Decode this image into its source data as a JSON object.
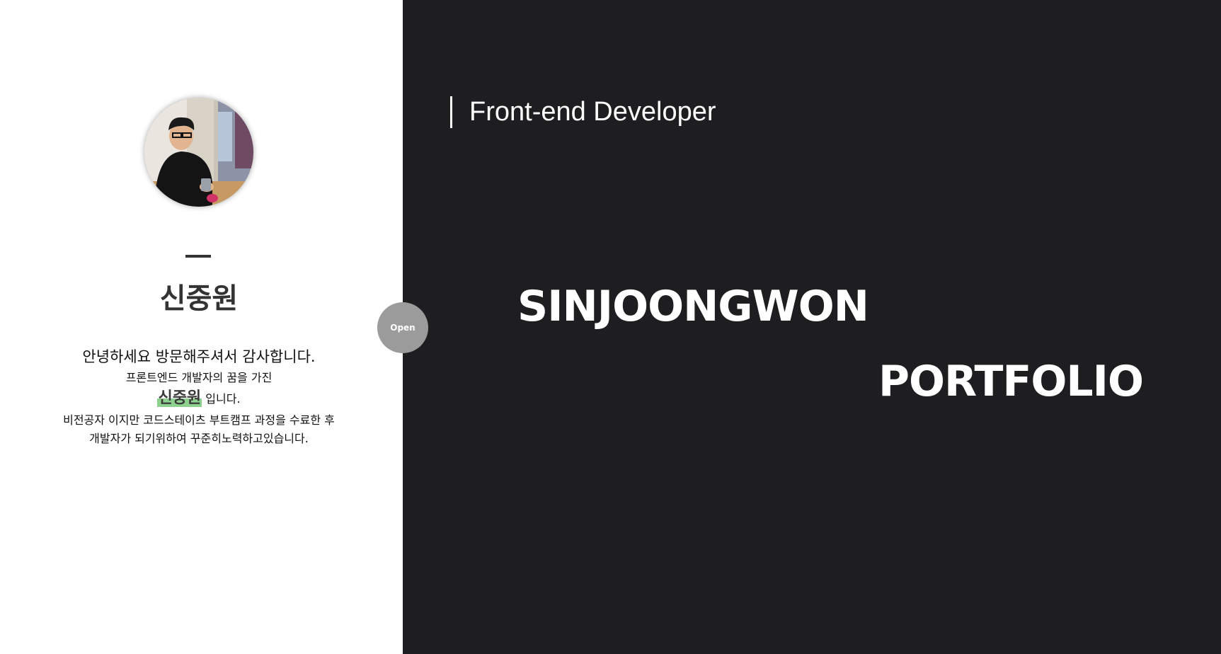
{
  "profile": {
    "name": "신중원",
    "intro": {
      "greeting": "안녕하세요 방문해주셔서 감사합니다.",
      "dream": "프론트엔드 개발자의 꿈을 가진",
      "highlight_name": "신중원",
      "name_suffix": "입니다.",
      "story_line_1": "비전공자 이지만 코드스테이츠 부트캠프 과정을 수료한 후",
      "story_line_2": "개발자가 되기위하여 꾸준히노력하고있습니다."
    }
  },
  "toggle": {
    "label": "Open"
  },
  "hero": {
    "role": "Front-end Developer",
    "name": "SINJOONGWON",
    "subtitle": "PORTFOLIO"
  },
  "colors": {
    "left_background": "#ffffff",
    "right_background": "#1e1e20",
    "accent_highlight": "#8ed18f",
    "toggle_background": "#9b9b9b"
  }
}
